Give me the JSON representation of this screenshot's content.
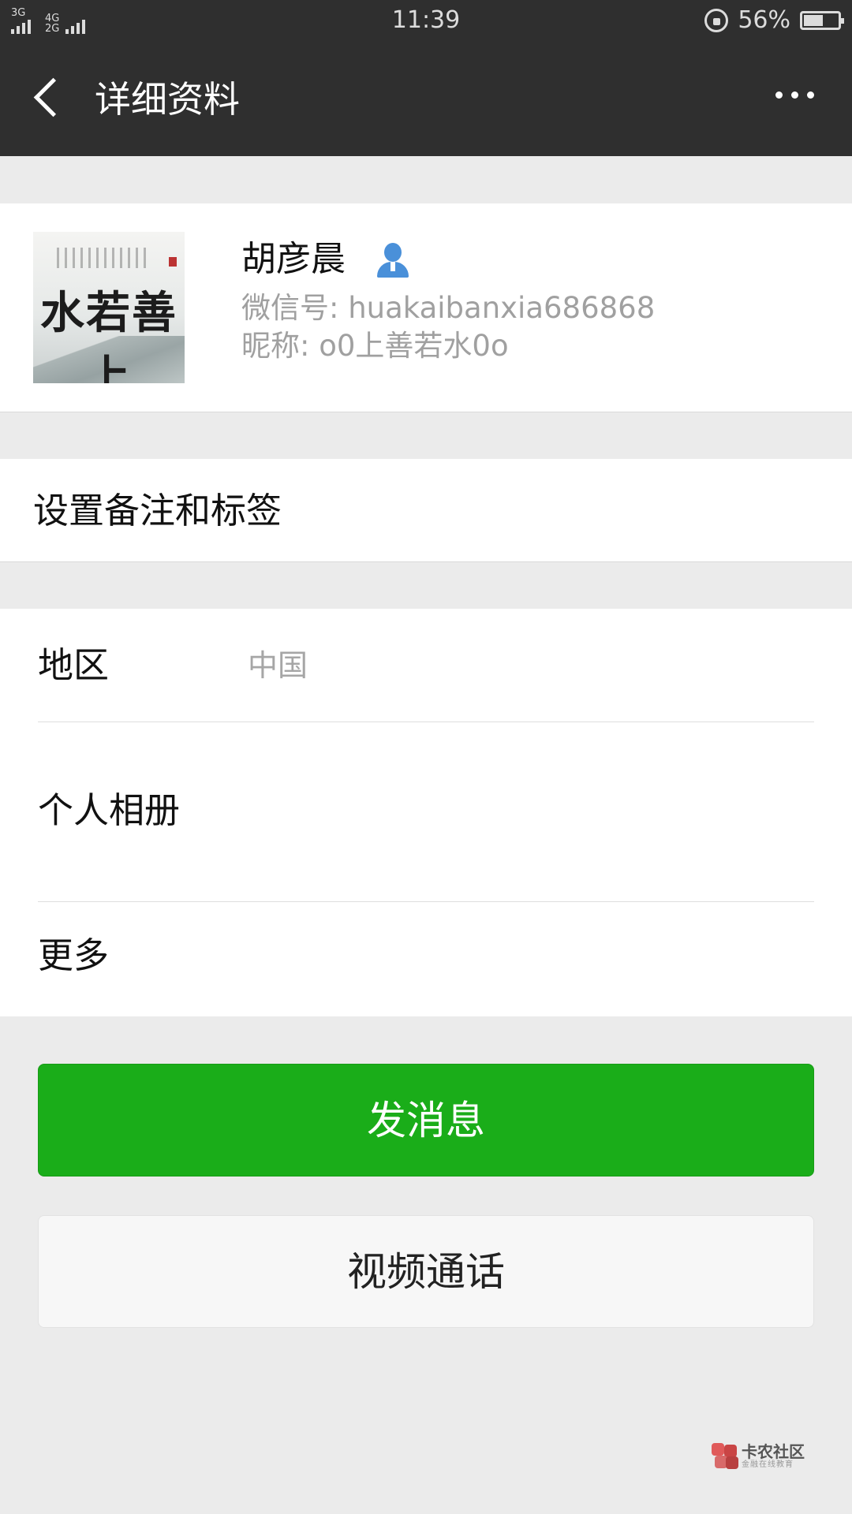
{
  "status_bar": {
    "network_1": "3G",
    "network_2_top": "4G",
    "network_2_bottom": "2G",
    "time": "11:39",
    "battery_percent": "56%",
    "battery_level": 0.56
  },
  "header": {
    "title": "详细资料"
  },
  "profile": {
    "name": "胡彦晨",
    "wechat_id": "微信号: huakaibanxia686868",
    "nickname": "昵称: o0上善若水0o",
    "avatar_text": "水若善上"
  },
  "remark": {
    "label": "设置备注和标签"
  },
  "info_rows": [
    {
      "label": "地区",
      "value": "中国"
    },
    {
      "label": "个人相册",
      "value": ""
    },
    {
      "label": "更多",
      "value": ""
    }
  ],
  "buttons": {
    "send_message": "发消息",
    "video_call": "视频通话"
  },
  "watermark": {
    "title": "卡农社区",
    "subtitle": "金融在线教育"
  },
  "colors": {
    "header_bg": "#2f2f2f",
    "page_bg": "#ebebeb",
    "primary_green": "#1aad19",
    "icon_blue": "#4a90d9"
  }
}
